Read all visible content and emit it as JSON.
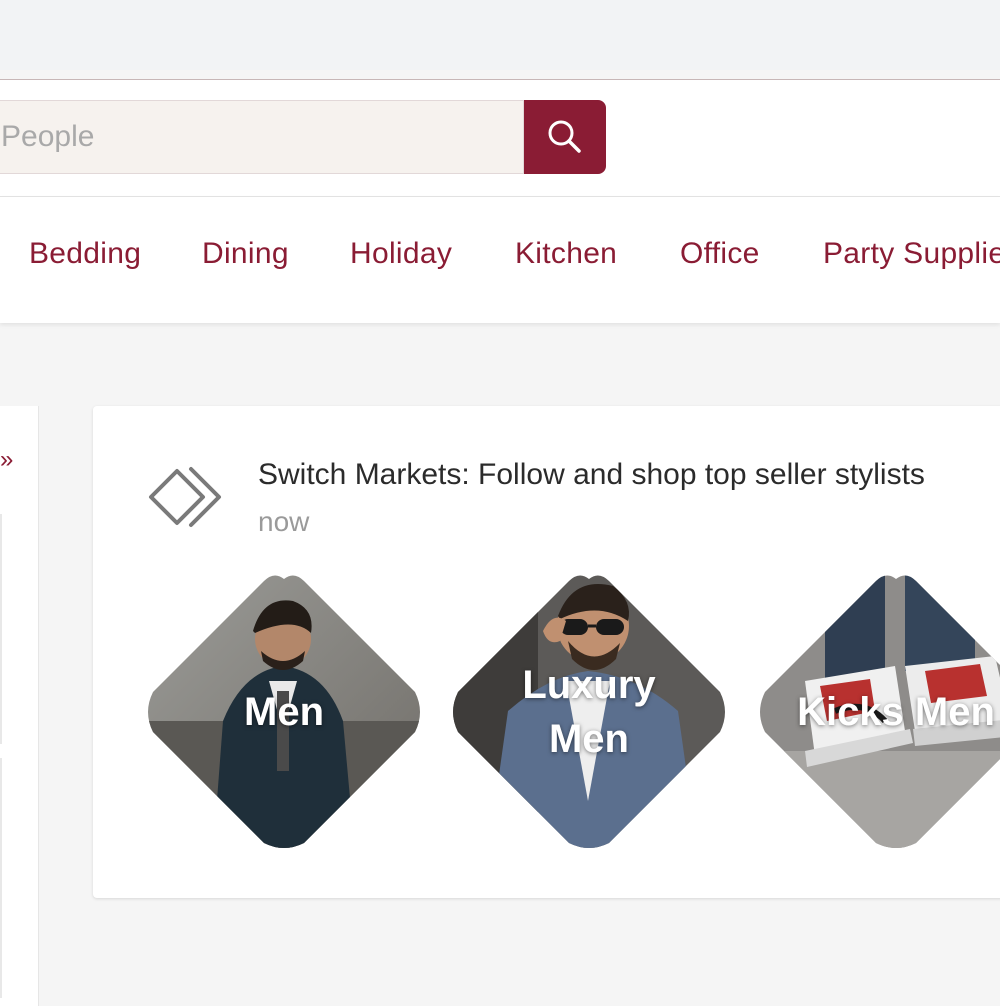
{
  "search": {
    "placeholder": "People"
  },
  "nav": {
    "items": [
      {
        "label": "Bedding"
      },
      {
        "label": "Dining"
      },
      {
        "label": "Holiday"
      },
      {
        "label": "Kitchen"
      },
      {
        "label": "Office"
      },
      {
        "label": "Party Supplies"
      }
    ]
  },
  "left_panel": {
    "chevron": "»"
  },
  "card": {
    "title": "Switch Markets: Follow and shop top seller stylists",
    "time": "now",
    "tiles": [
      {
        "label": "Men"
      },
      {
        "label": "Luxury\nMen"
      },
      {
        "label": "Kicks Men"
      }
    ]
  },
  "colors": {
    "accent": "#8a1c34",
    "card_bg": "#ffffff",
    "page_bg": "#f5f5f5"
  }
}
